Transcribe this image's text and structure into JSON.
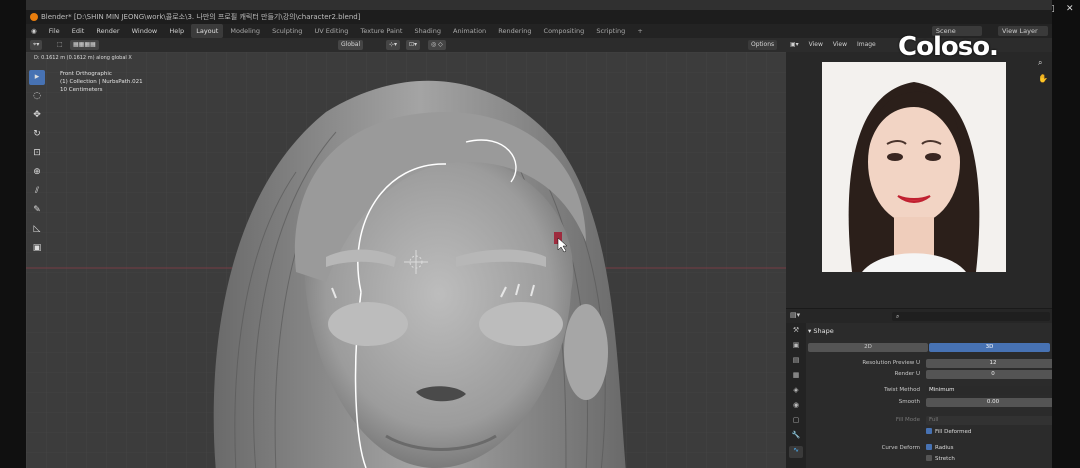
{
  "titlebar": {
    "title": "Blender* [D:\\SHIN MIN JEONG\\work\\콜로소\\3. 나만의 프로필 캐릭터 만들기\\강의\\character2.blend]",
    "minimize": "–",
    "maximize": "□",
    "close": "✕"
  },
  "menu": {
    "items": [
      "File",
      "Edit",
      "Render",
      "Window",
      "Help"
    ],
    "tabs": [
      "Layout",
      "Modeling",
      "Sculpting",
      "UV Editing",
      "Texture Paint",
      "Shading",
      "Animation",
      "Rendering",
      "Compositing",
      "Scripting"
    ],
    "active_tab": "Layout",
    "add": "+",
    "scene": "Scene",
    "view_layer": "View Layer"
  },
  "viewport": {
    "orientation": "Global",
    "options": "Options",
    "status": "D: 0.1612 m (0.1612 m) along global X",
    "info": [
      "Front Orthographic",
      "(1) Collection | NurbsPath.021",
      "10 Centimeters"
    ]
  },
  "image_editor": {
    "menu": [
      "View",
      "View",
      "Image"
    ],
    "watermark": "Coloso."
  },
  "properties": {
    "section": "Shape",
    "mode_2d": "2D",
    "mode_3d": "3D",
    "rows": [
      {
        "label": "Resolution Preview U",
        "value": "12"
      },
      {
        "label": "Render U",
        "value": "0"
      },
      {
        "label": "Twist Method",
        "value": "Minimum"
      },
      {
        "label": "Smooth",
        "value": "0.00"
      },
      {
        "label": "Fill Mode",
        "value": "Full"
      },
      {
        "label": "",
        "value": "Fill Deformed"
      },
      {
        "label": "Curve Deform",
        "value": "Radius"
      },
      {
        "label": "",
        "value": "Stretch"
      }
    ]
  }
}
